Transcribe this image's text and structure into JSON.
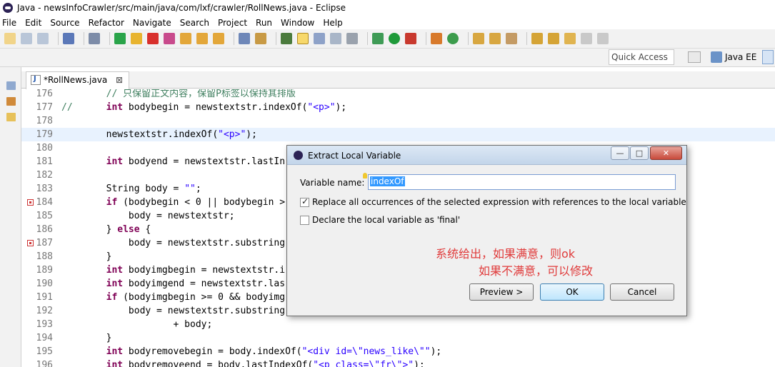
{
  "window": {
    "title": "Java - newsInfoCrawler/src/main/java/com/lxf/crawler/RollNews.java - Eclipse"
  },
  "menu": [
    "File",
    "Edit",
    "Source",
    "Refactor",
    "Navigate",
    "Search",
    "Project",
    "Run",
    "Window",
    "Help"
  ],
  "quick_access": "Quick Access",
  "perspective": "Java EE",
  "editor_tab": {
    "label": "*RollNews.java",
    "close": "⊠"
  },
  "code_lines": [
    {
      "num": "176",
      "text": "        // 只保留正文内容，保留P标签以保持其排版"
    },
    {
      "num": "177",
      "text": "//      int bodybegin = newstextstr.indexOf(\"<p>\");"
    },
    {
      "num": "178",
      "text": ""
    },
    {
      "num": "179",
      "text": "        newstextstr.indexOf(\"<p>\");"
    },
    {
      "num": "180",
      "text": ""
    },
    {
      "num": "181",
      "text": "        int bodyend = newstextstr.lastIn"
    },
    {
      "num": "182",
      "text": ""
    },
    {
      "num": "183",
      "text": "        String body = \"\";"
    },
    {
      "num": "184",
      "text": "        if (bodybegin < 0 || bodybegin >"
    },
    {
      "num": "185",
      "text": "            body = newstextstr;"
    },
    {
      "num": "186",
      "text": "        } else {"
    },
    {
      "num": "187",
      "text": "            body = newstextstr.substring"
    },
    {
      "num": "188",
      "text": "        }"
    },
    {
      "num": "189",
      "text": "        int bodyimgbegin = newstextstr.i"
    },
    {
      "num": "190",
      "text": "        int bodyimgend = newstextstr.las"
    },
    {
      "num": "191",
      "text": "        if (bodyimgbegin >= 0 && bodyimg"
    },
    {
      "num": "192",
      "text": "            body = newstextstr.substring"
    },
    {
      "num": "193",
      "text": "                    + body;"
    },
    {
      "num": "194",
      "text": "        }"
    },
    {
      "num": "195",
      "text": "        int bodyremovebegin = body.indexOf(\"<div id=\\\"news_like\\\"\");"
    },
    {
      "num": "196",
      "text": "        int bodyremoveend = body.lastIndexOf(\"<p class=\\\"fr\\\">\");"
    }
  ],
  "dialog": {
    "title": "Extract Local Variable",
    "variable_label": "Variable name:",
    "variable_value": "indexOf",
    "replace_label": "Replace all occurrences of the selected expression with references to the local variable",
    "replace_checked": true,
    "final_label": "Declare the local variable as 'final'",
    "final_checked": false,
    "note_line1": "系统给出，如果满意，则ok",
    "note_line2": "如果不满意，可以修改",
    "buttons": {
      "preview": "Preview >",
      "ok": "OK",
      "cancel": "Cancel"
    },
    "window_buttons": {
      "minimize": "—",
      "maximize": "□",
      "close": "✕"
    }
  },
  "colors": {
    "keyword": "#7f0055",
    "string": "#2a00ff",
    "comment": "#3f7f5f",
    "current_line": "#e8f2fe",
    "note": "#e03a3a"
  },
  "icons": [
    "eclipse-icon",
    "new-icon",
    "save-icon",
    "run-icon",
    "debug-icon",
    "java-file-icon",
    "error-marker-icon",
    "lightbulb-icon"
  ]
}
